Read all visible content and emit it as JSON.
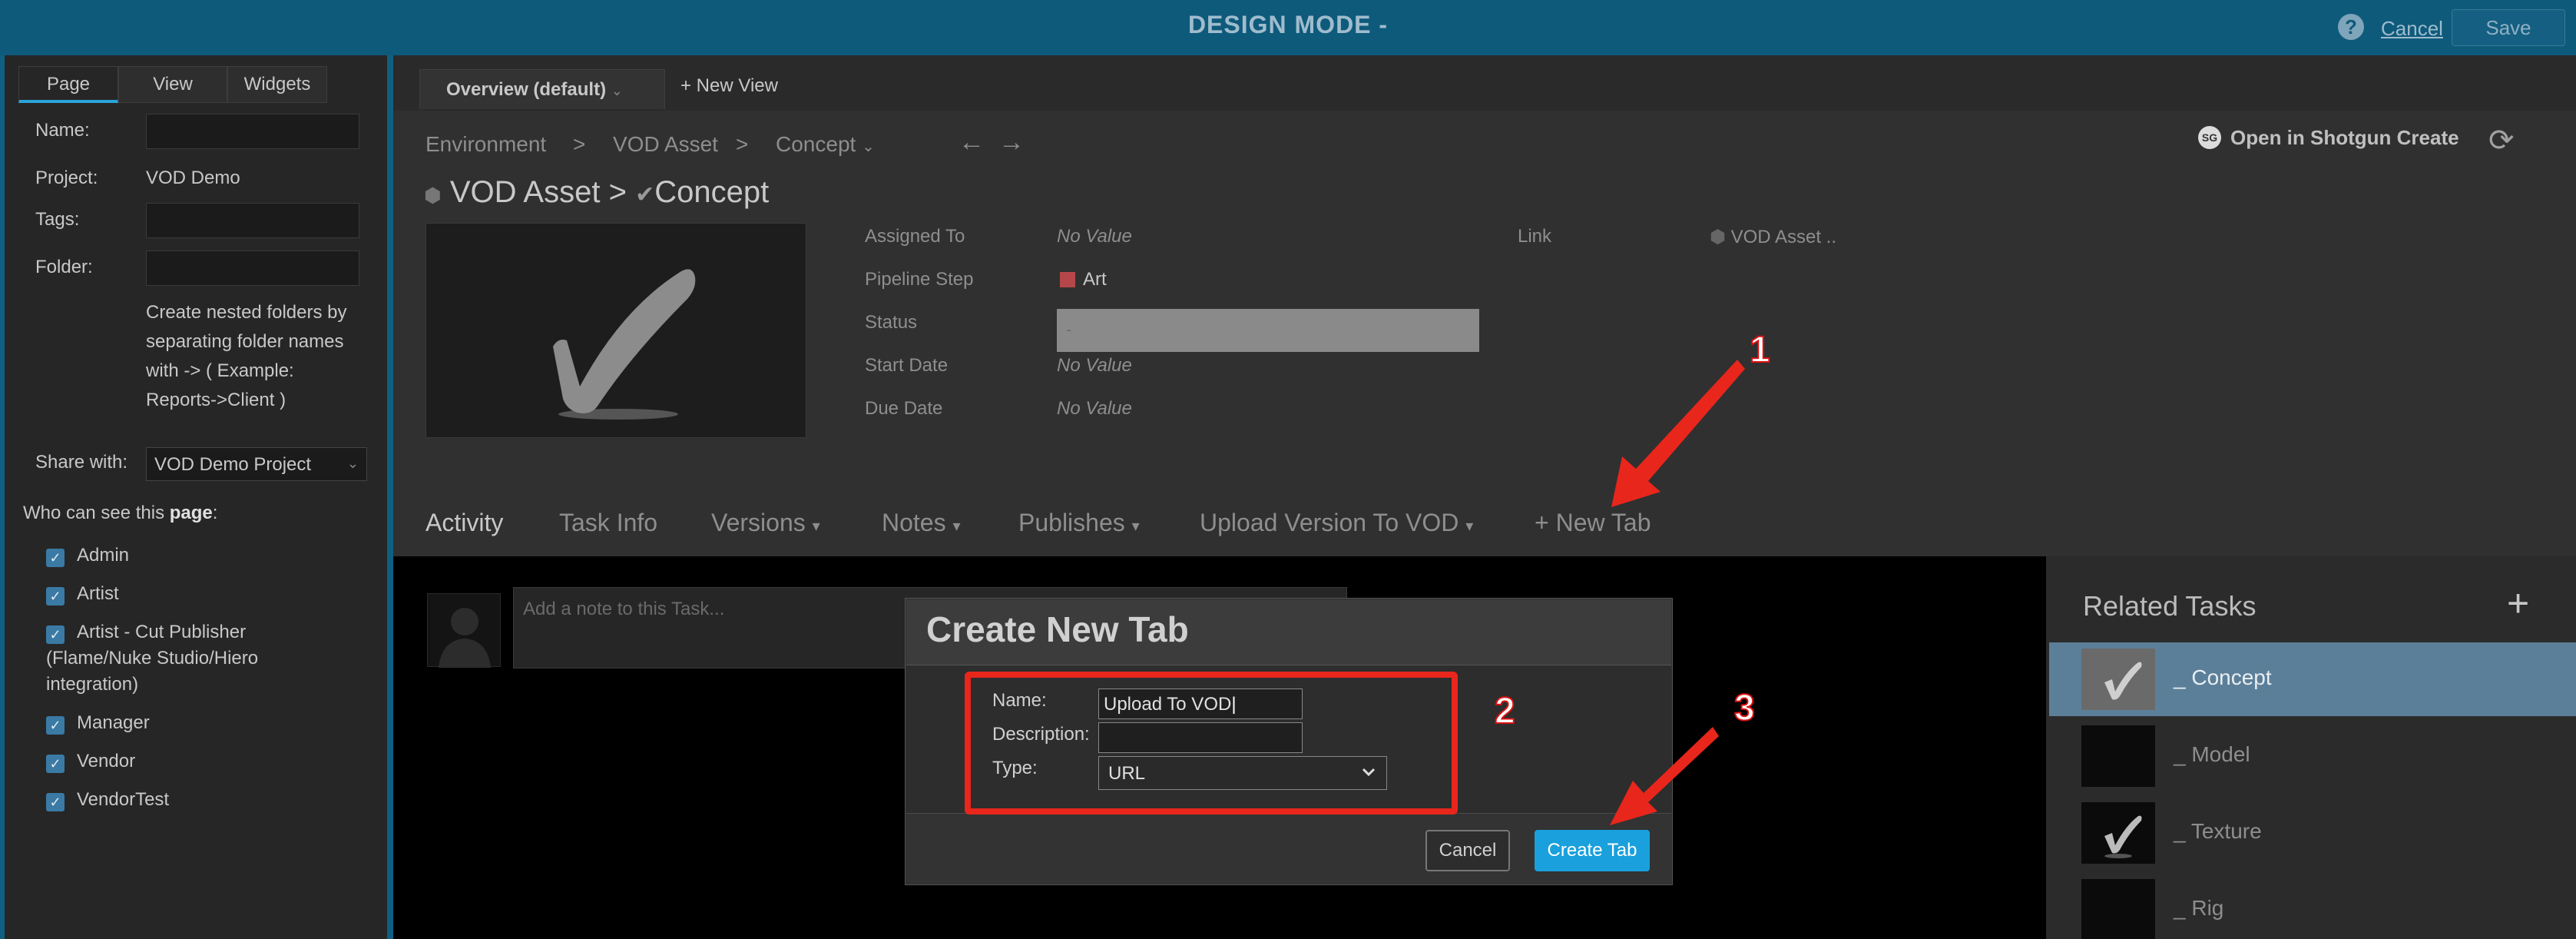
{
  "topbar": {
    "title": "DESIGN MODE -",
    "help": "?",
    "cancel": "Cancel",
    "save": "Save"
  },
  "left": {
    "tabs": [
      "Page",
      "View",
      "Widgets"
    ],
    "name_label": "Name:",
    "project_label": "Project:",
    "project_value": "VOD Demo",
    "tags_label": "Tags:",
    "folder_label": "Folder:",
    "folder_help": "Create nested folders by separating folder names with -> ( Example: Reports->Client )",
    "share_label": "Share with:",
    "share_value": "VOD Demo Project",
    "who_label_pre": "Who can see this ",
    "who_label_bold": "page",
    "who_label_post": ":",
    "permissions": [
      "Admin",
      "Artist",
      "Artist - Cut Publisher (Flame/Nuke Studio/Hiero integration)",
      "Manager",
      "Vendor",
      "VendorTest"
    ]
  },
  "views": {
    "current": "Overview (default)",
    "current_chev": "⌄",
    "new": "+ New View"
  },
  "breadcrumb": {
    "a": "Environment",
    "sep1": ">",
    "b": "VOD Asset",
    "sep2": ">",
    "c": "Concept",
    "chev": "⌄",
    "back": "←",
    "fwd": "→"
  },
  "entity": {
    "title_a": "VOD Asset",
    "sep": ">",
    "title_b": "Concept"
  },
  "fields": {
    "assigned_label": "Assigned To",
    "assigned_value": "No Value",
    "step_label": "Pipeline Step",
    "step_value": "Art",
    "status_label": "Status",
    "status_value": "-",
    "start_label": "Start Date",
    "start_value": "No Value",
    "due_label": "Due Date",
    "due_value": "No Value",
    "link_label": "Link",
    "link_value": "VOD Asset .."
  },
  "open_sg": "Open in Shotgun Create",
  "sg_logo": "SG",
  "tabs": [
    "Activity",
    "Task Info",
    "Versions",
    "Notes",
    "Publishes",
    "Upload Version To VOD",
    "+ New Tab"
  ],
  "tab_chev": "▾",
  "note_placeholder": "Add a note to this Task...",
  "related": {
    "title": "Related Tasks",
    "add": "+",
    "tasks": [
      "_ Concept",
      "_ Model",
      "_ Texture",
      "_ Rig"
    ]
  },
  "modal": {
    "title": "Create New Tab",
    "name_label": "Name:",
    "name_value": "Upload To VOD",
    "desc_label": "Description:",
    "desc_value": "",
    "type_label": "Type:",
    "type_value": "URL",
    "cancel": "Cancel",
    "create": "Create Tab"
  },
  "annotations": {
    "n1": "1",
    "n2": "2",
    "n3": "3"
  },
  "colors": {
    "accent": "#1aa0dc",
    "topbar": "#0e5a7b",
    "annotation": "#e8261c",
    "selected_row": "#5c7f99"
  }
}
